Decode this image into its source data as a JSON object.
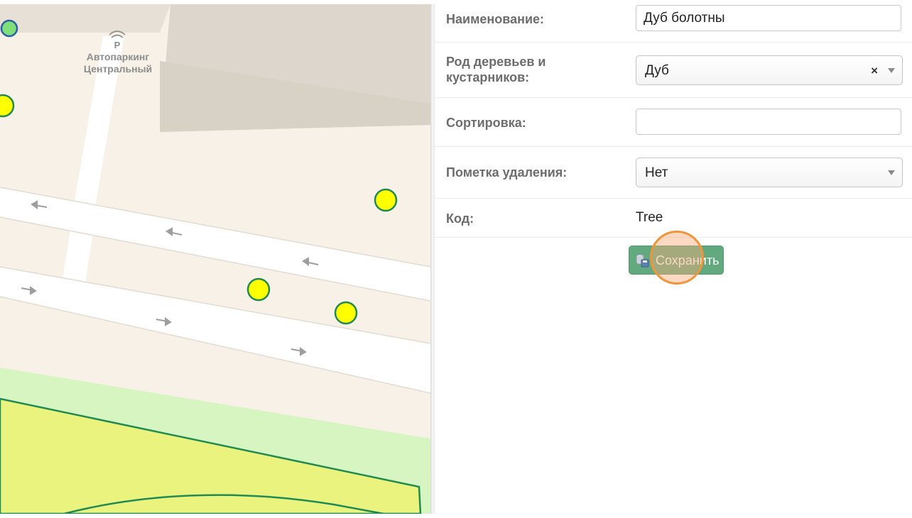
{
  "map": {
    "parking_label_line1": "Автопаркинг",
    "parking_label_line2": "Центральный",
    "parking_icon": "parking-icon",
    "colors": {
      "ground": "#f7f1e8",
      "building": "#e0d9cf",
      "road": "#ffffff",
      "park": "#d7f5c0",
      "lawn": "#e8f27a",
      "lawn_border": "#1f8a52",
      "tree_marker": "#ffff00",
      "tree_marker_border": "#1f8a52"
    }
  },
  "form": {
    "fields": {
      "name": {
        "label": "Наименование:",
        "value": "Дуб болотны"
      },
      "genus": {
        "label_line1": "Род деревьев и",
        "label_line2": "кустарников:",
        "value": "Дуб",
        "clear": "×"
      },
      "sort": {
        "label": "Сортировка:",
        "value": ""
      },
      "deletion_mark": {
        "label": "Пометка удаления:",
        "value": "Нет"
      },
      "code": {
        "label": "Код:",
        "value": "Tree"
      }
    },
    "save_button": {
      "label": "Сохранить",
      "icon": "save-database-icon"
    },
    "colors": {
      "label": "#6d6d6d",
      "button": "#62a97f",
      "highlight": "#f0953a"
    }
  }
}
